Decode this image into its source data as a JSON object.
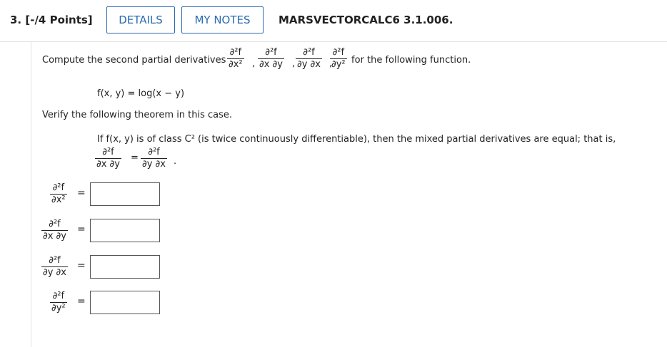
{
  "header": {
    "question_number": "3. [-/4 Points]",
    "details_label": "DETAILS",
    "notes_label": "MY NOTES",
    "question_id": "MARSVECTORCALC6 3.1.006."
  },
  "prompt": {
    "intro": "Compute the second partial derivatives",
    "trailer": "for the following function.",
    "function": "f(x, y) = log(x − y)",
    "verify": "Verify the following theorem in this case.",
    "theorem": "If f(x, y) is of class C² (is twice continuously differentiable), then the mixed partial derivatives are equal; that is,"
  },
  "fractions": {
    "d2f": "∂²f",
    "dx2": "∂x²",
    "dxdy": "∂x ∂y",
    "dydx": "∂y ∂x",
    "dy2": "∂y²"
  },
  "answers": [
    {
      "num": "∂²f",
      "den": "∂x²",
      "value": ""
    },
    {
      "num": "∂²f",
      "den": "∂x ∂y",
      "value": ""
    },
    {
      "num": "∂²f",
      "den": "∂y ∂x",
      "value": ""
    },
    {
      "num": "∂²f",
      "den": "∂y²",
      "value": ""
    }
  ],
  "colors": {
    "accent": "#2a6bb0"
  }
}
